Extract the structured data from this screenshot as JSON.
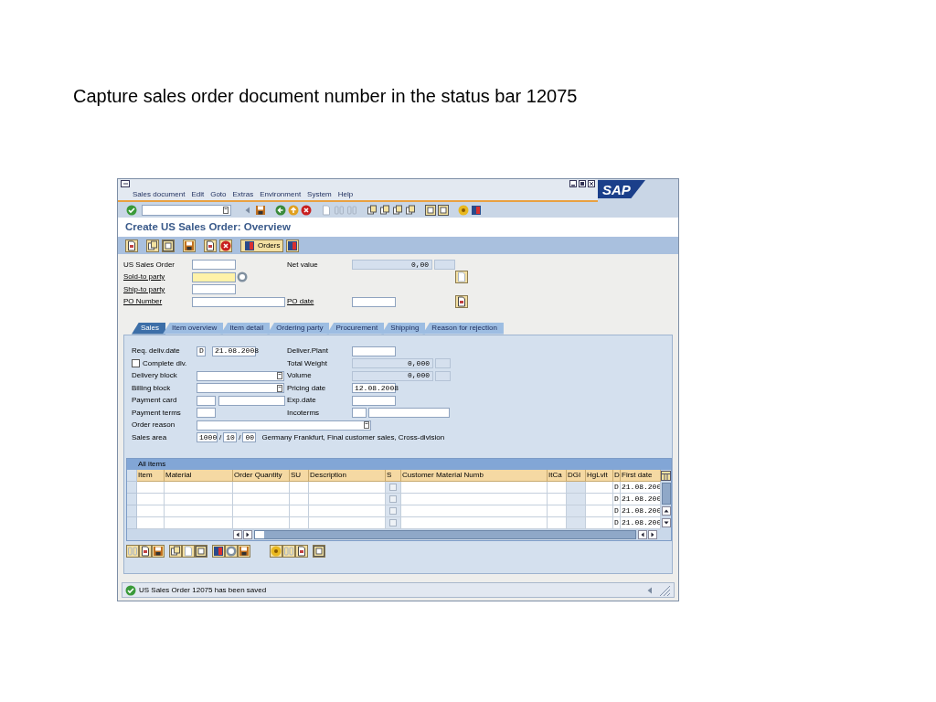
{
  "slide_title": "Capture sales order document number in the status bar 12075",
  "menu": [
    "Sales document",
    "Edit",
    "Goto",
    "Extras",
    "Environment",
    "System",
    "Help"
  ],
  "logo": "SAP",
  "screen_title": "Create US Sales Order: Overview",
  "orders_button": "Orders",
  "header": {
    "fields": [
      {
        "label": "US Sales Order",
        "link": false,
        "required": false
      },
      {
        "label": "Sold-to party",
        "link": true,
        "required": true
      },
      {
        "label": "Ship-to party",
        "link": true,
        "required": false
      },
      {
        "label": "PO Number",
        "link": true,
        "required": false
      }
    ],
    "net_value": {
      "label": "Net value",
      "value": "0,00"
    },
    "po_date": {
      "label": "PO date",
      "link": true
    }
  },
  "tabs": [
    {
      "label": "Sales",
      "selected": true
    },
    {
      "label": "Item overview",
      "selected": false
    },
    {
      "label": "Item detail",
      "selected": false
    },
    {
      "label": "Ordering party",
      "selected": false
    },
    {
      "label": "Procurement",
      "selected": false
    },
    {
      "label": "Shipping",
      "selected": false
    },
    {
      "label": "Reason for rejection",
      "selected": false
    }
  ],
  "sales": {
    "left": [
      {
        "kind": "date",
        "label": "Req. deliv.date",
        "type": "D",
        "value": "21.08.2008"
      },
      {
        "kind": "checkbox",
        "label": "Complete dlv.",
        "checked": false
      },
      {
        "kind": "dropdown",
        "label": "Delivery block"
      },
      {
        "kind": "dropdown",
        "label": "Billing block"
      },
      {
        "kind": "pair",
        "label": "Payment card"
      },
      {
        "kind": "input",
        "label": "Payment terms"
      },
      {
        "kind": "wide_dropdown",
        "label": "Order reason"
      },
      {
        "kind": "area",
        "label": "Sales area",
        "values": [
          "1000",
          "10",
          "00"
        ],
        "separators": [
          "/",
          "/"
        ],
        "text": "Germany Frankfurt, Final customer sales, Cross-division"
      }
    ],
    "right": [
      {
        "kind": "input",
        "label": "Deliver.Plant"
      },
      {
        "kind": "display",
        "label": "Total Weight",
        "value": "0,000"
      },
      {
        "kind": "display",
        "label": "Volume",
        "value": "0,000"
      },
      {
        "kind": "input",
        "label": "Pricing date",
        "value": "12.08.2008"
      },
      {
        "kind": "input",
        "label": "Exp.date"
      },
      {
        "kind": "pair",
        "label": "Incoterms"
      }
    ]
  },
  "table": {
    "title": "All items",
    "columns": [
      "Item",
      "Material",
      "Order Quantity",
      "SU",
      "Description",
      "S",
      "Customer Material Numb",
      "ItCa",
      "DGI",
      "HgLvlt",
      "D",
      "First date"
    ],
    "rows": [
      {
        "d": "D",
        "first_date": "21.08.200",
        "s_checked": false
      },
      {
        "d": "D",
        "first_date": "21.08.200",
        "s_checked": false
      },
      {
        "d": "D",
        "first_date": "21.08.200",
        "s_checked": false
      },
      {
        "d": "D",
        "first_date": "21.08.200",
        "s_checked": false
      }
    ]
  },
  "status_bar": {
    "message": "US Sales Order 12075 has been saved"
  }
}
